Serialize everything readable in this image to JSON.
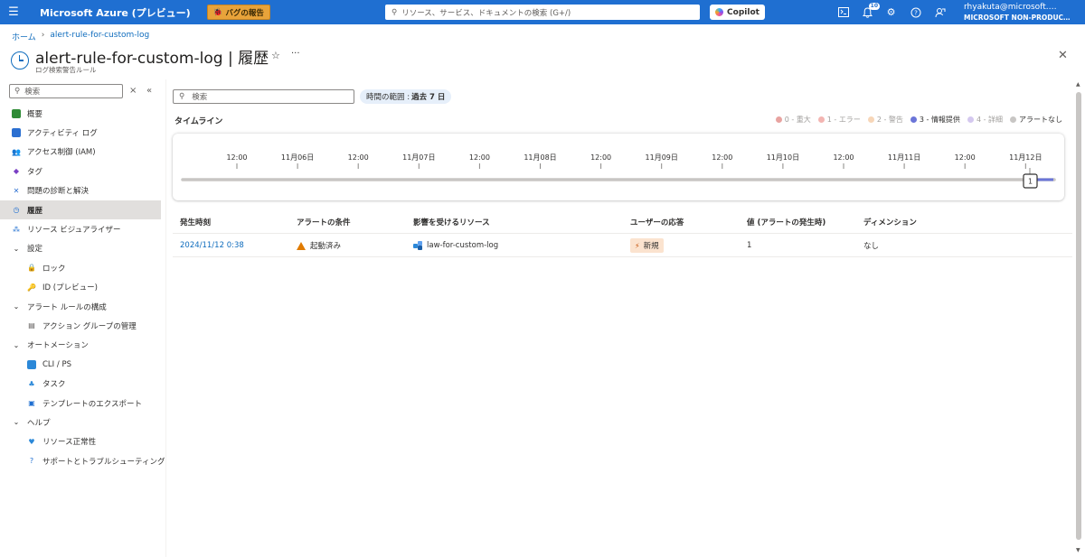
{
  "topbar": {
    "brand": "Microsoft Azure (プレビュー)",
    "bug_report": "バグの報告",
    "search_placeholder": "リソース、サービス、ドキュメントの検索 (G+/)",
    "copilot": "Copilot",
    "notification_count": "10",
    "user_email": "rhyakuta@microsoft.…",
    "user_tenant": "MICROSOFT NON-PRODUC…"
  },
  "breadcrumb": {
    "home": "ホーム",
    "resource": "alert-rule-for-custom-log"
  },
  "page": {
    "title": "alert-rule-for-custom-log | 履歴",
    "subtitle": "ログ検索警告ルール"
  },
  "sidebar": {
    "search_placeholder": "検索",
    "items": [
      {
        "label": "概要",
        "icon": "overview-icon",
        "level": 0
      },
      {
        "label": "アクティビティ ログ",
        "icon": "activity-log-icon",
        "level": 0
      },
      {
        "label": "アクセス制御 (IAM)",
        "icon": "iam-icon",
        "level": 0
      },
      {
        "label": "タグ",
        "icon": "tag-icon",
        "level": 0
      },
      {
        "label": "問題の診断と解決",
        "icon": "diagnose-icon",
        "level": 0
      },
      {
        "label": "履歴",
        "icon": "history-icon",
        "level": 0,
        "selected": true
      },
      {
        "label": "リソース ビジュアライザー",
        "icon": "visualizer-icon",
        "level": 0
      },
      {
        "label": "設定",
        "group": true
      },
      {
        "label": "ロック",
        "icon": "lock-icon",
        "level": 1
      },
      {
        "label": "ID (プレビュー)",
        "icon": "identity-icon",
        "level": 1
      },
      {
        "label": "アラート ルールの構成",
        "group": true
      },
      {
        "label": "アクション グループの管理",
        "icon": "action-group-icon",
        "level": 1
      },
      {
        "label": "オートメーション",
        "group": true
      },
      {
        "label": "CLI / PS",
        "icon": "cli-icon",
        "level": 1
      },
      {
        "label": "タスク",
        "icon": "task-icon",
        "level": 1
      },
      {
        "label": "テンプレートのエクスポート",
        "icon": "export-template-icon",
        "level": 1
      },
      {
        "label": "ヘルプ",
        "group": true
      },
      {
        "label": "リソース正常性",
        "icon": "health-icon",
        "level": 1
      },
      {
        "label": "サポートとトラブルシューティング",
        "icon": "support-icon",
        "level": 1
      }
    ]
  },
  "main": {
    "search_placeholder": "検索",
    "time_range_label": "時間の範囲 :",
    "time_range_value": "過去 7 日",
    "timeline_title": "タイムライン",
    "legend": [
      {
        "label": "0 - 重大",
        "color": "#e8a3a0",
        "text_color": "#a19f9d"
      },
      {
        "label": "1 - エラー",
        "color": "#f3b5b2",
        "text_color": "#a19f9d"
      },
      {
        "label": "2 - 警告",
        "color": "#f7d6b8",
        "text_color": "#a19f9d"
      },
      {
        "label": "3 - 情報提供",
        "color": "#6b75d8",
        "text_color": "#323130"
      },
      {
        "label": "4 - 詳細",
        "color": "#d4c8ef",
        "text_color": "#a19f9d"
      },
      {
        "label": "アラートなし",
        "color": "#c8c6c4",
        "text_color": "#323130"
      }
    ],
    "timeline_ticks": [
      "12:00",
      "11月06日",
      "12:00",
      "11月07日",
      "12:00",
      "11月08日",
      "12:00",
      "11月09日",
      "12:00",
      "11月10日",
      "12:00",
      "11月11日",
      "12:00",
      "11月12日"
    ],
    "timeline_marker": "1",
    "table": {
      "headers": [
        "発生時刻",
        "アラートの条件",
        "影響を受けるリソース",
        "ユーザーの応答",
        "値 (アラートの発生時)",
        "ディメンション"
      ],
      "rows": [
        {
          "time": "2024/11/12 0:38",
          "condition": "起動済み",
          "resource": "law-for-custom-log",
          "response": "新規",
          "value": "1",
          "dimension": "なし"
        }
      ]
    }
  }
}
